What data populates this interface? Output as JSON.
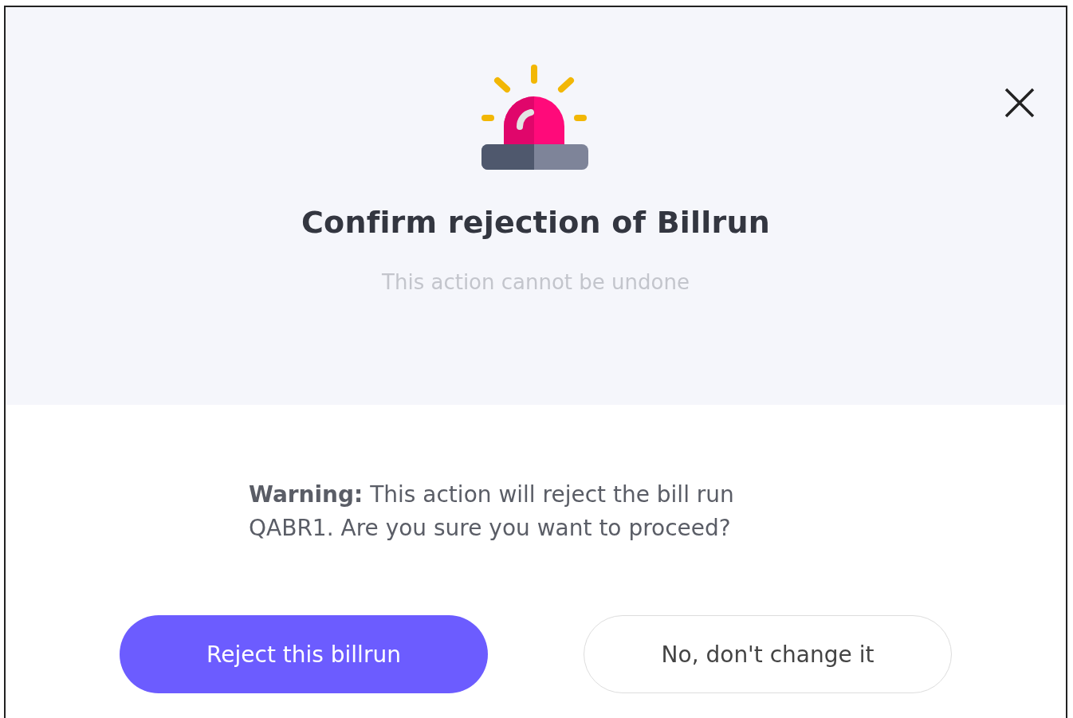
{
  "dialog": {
    "title": "Confirm rejection of Billrun",
    "subtitle": "This action cannot be undone",
    "message": "**Warning:** This action will reject the bill run QABR1. Are you sure you want to proceed?",
    "buttons": [
      {
        "label": "Reject this billrun",
        "kind": "primary"
      },
      {
        "label": "No, don't change it",
        "kind": "secondary"
      }
    ]
  }
}
